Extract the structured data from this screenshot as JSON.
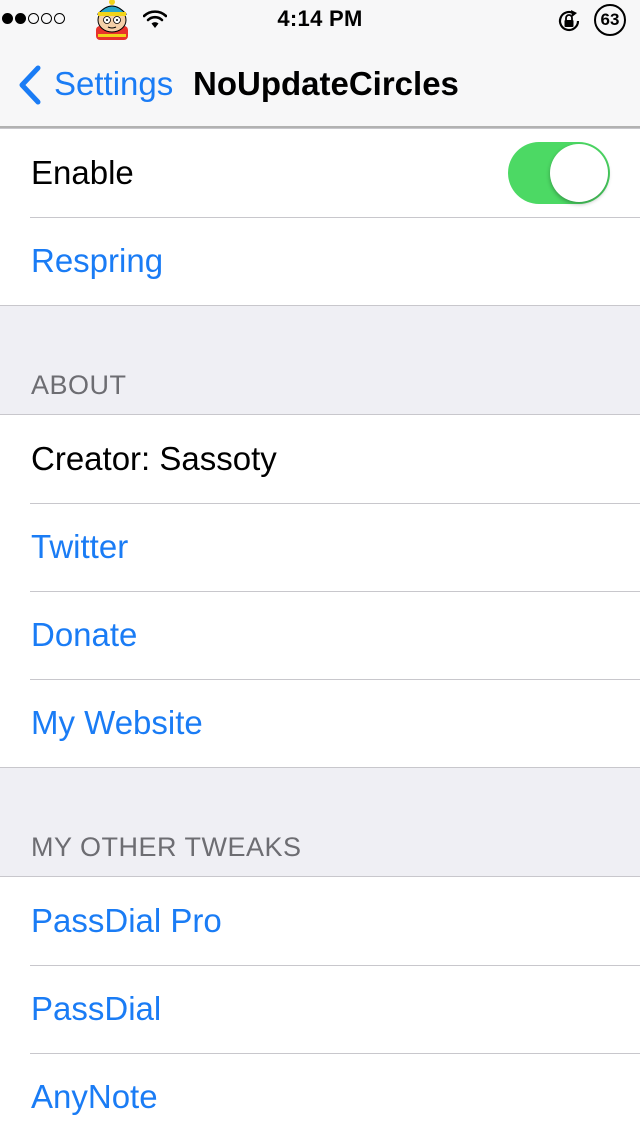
{
  "status_bar": {
    "signal_dots": [
      "filled",
      "filled",
      "empty",
      "empty",
      "empty"
    ],
    "carrier_icon": "cartman-avatar",
    "wifi_icon": "wifi-icon",
    "time": "4:14 PM",
    "rotation_lock_icon": "rotation-lock-icon",
    "battery_percent": "63"
  },
  "nav": {
    "back_label": "Settings",
    "title": "NoUpdateCircles"
  },
  "main_group": {
    "enable_label": "Enable",
    "enable_on": true,
    "respring_label": "Respring"
  },
  "about": {
    "header": "ABOUT",
    "items": [
      "Creator: Sassoty",
      "Twitter",
      "Donate",
      "My Website"
    ]
  },
  "other_tweaks": {
    "header": "MY OTHER TWEAKS",
    "items": [
      "PassDial Pro",
      "PassDial",
      "AnyNote"
    ]
  },
  "colors": {
    "tint": "#1a7cf5",
    "toggle_on": "#4cd964",
    "background": "#efeff4",
    "section_header": "#6d6d72"
  }
}
